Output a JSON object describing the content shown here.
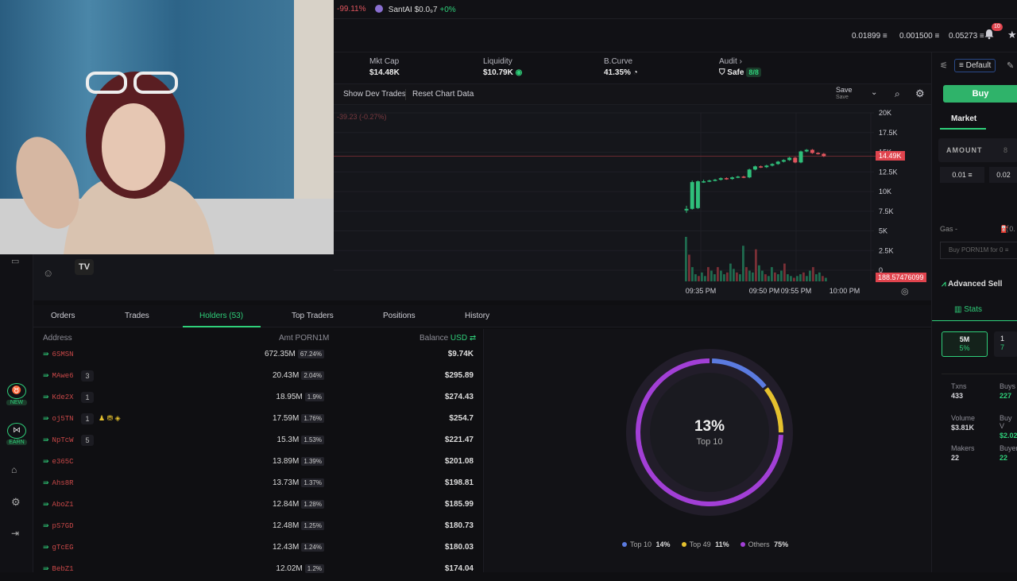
{
  "topbar": {
    "left_change": "-99.11%",
    "ticker_name": "SantAI",
    "ticker_price": "$0.0₉7",
    "ticker_change": "+0%"
  },
  "header": {
    "prices": [
      "0.01899 ≡",
      "0.001500 ≡",
      "0.05273 ≡"
    ],
    "notif_count": "10"
  },
  "stats": {
    "mktcap_label": "Mkt Cap",
    "mktcap": "$14.48K",
    "liquidity_label": "Liquidity",
    "liquidity": "$10.79K",
    "bcurve_label": "B.Curve",
    "bcurve": "41.35%",
    "audit_label": "Audit",
    "audit_status": "Safe",
    "audit_score": "8/8"
  },
  "chart_toolbar": {
    "show_dev": "Show Dev Trades",
    "reset": "Reset Chart Data",
    "save": "Save",
    "save_sub": "Save"
  },
  "chart_data": {
    "type": "candlestick",
    "change_label": "-39.23 (-0.27%)",
    "y_ticks": [
      "20K",
      "17.5K",
      "15K",
      "12.5K",
      "10K",
      "7.5K",
      "5K",
      "2.5K",
      "0"
    ],
    "y_tick_values": [
      20000,
      17500,
      15000,
      12500,
      10000,
      7500,
      5000,
      2500,
      0
    ],
    "x_ticks": [
      "09:35 PM",
      "09:50 PM",
      "09:55 PM",
      "10:00 PM"
    ],
    "current_price_label": "14.49K",
    "current_price": 14490,
    "volume_label": "188.57476099",
    "candles": [
      {
        "o": 7600,
        "c": 7800,
        "h": 8200,
        "l": 7300
      },
      {
        "o": 7800,
        "c": 11200,
        "h": 11400,
        "l": 7700
      },
      {
        "o": 7900,
        "c": 11300,
        "h": 11400,
        "l": 7800
      },
      {
        "o": 11200,
        "c": 11300,
        "h": 11500,
        "l": 11100
      },
      {
        "o": 11300,
        "c": 11400,
        "h": 11500,
        "l": 11200
      },
      {
        "o": 11400,
        "c": 11500,
        "h": 11600,
        "l": 11300
      },
      {
        "o": 11500,
        "c": 11700,
        "h": 11800,
        "l": 11400
      },
      {
        "o": 11700,
        "c": 11600,
        "h": 11800,
        "l": 11500
      },
      {
        "o": 11600,
        "c": 11800,
        "h": 11900,
        "l": 11500
      },
      {
        "o": 11800,
        "c": 11900,
        "h": 12000,
        "l": 11700
      },
      {
        "o": 11900,
        "c": 11800,
        "h": 12000,
        "l": 11700
      },
      {
        "o": 11800,
        "c": 12800,
        "h": 12900,
        "l": 11700
      },
      {
        "o": 12800,
        "c": 13200,
        "h": 13300,
        "l": 12700
      },
      {
        "o": 13200,
        "c": 13100,
        "h": 13300,
        "l": 13000
      },
      {
        "o": 13100,
        "c": 13300,
        "h": 13400,
        "l": 13000
      },
      {
        "o": 13300,
        "c": 13500,
        "h": 13600,
        "l": 13200
      },
      {
        "o": 13500,
        "c": 13800,
        "h": 13900,
        "l": 13400
      },
      {
        "o": 13800,
        "c": 14000,
        "h": 14100,
        "l": 13700
      },
      {
        "o": 14000,
        "c": 14300,
        "h": 14400,
        "l": 13900
      },
      {
        "o": 14300,
        "c": 13700,
        "h": 14400,
        "l": 13600
      },
      {
        "o": 13700,
        "c": 15100,
        "h": 15200,
        "l": 13600
      },
      {
        "o": 15100,
        "c": 15300,
        "h": 15400,
        "l": 15000
      },
      {
        "o": 15300,
        "c": 14900,
        "h": 15400,
        "l": 14800
      },
      {
        "o": 14900,
        "c": 14800,
        "h": 15000,
        "l": 14700
      },
      {
        "o": 14800,
        "c": 14500,
        "h": 14900,
        "l": 14400
      }
    ],
    "volumes": [
      25,
      15,
      8,
      4,
      3,
      5,
      3,
      8,
      6,
      4,
      8,
      6,
      4,
      5,
      10,
      7,
      5,
      4,
      20,
      8,
      6,
      5,
      18,
      9,
      6,
      4,
      3,
      8,
      5,
      4,
      6,
      10,
      4,
      3,
      2,
      3,
      4,
      5,
      3,
      6,
      8,
      4,
      5,
      3,
      2
    ]
  },
  "tabs": [
    "Orders",
    "Trades",
    "Holders (53)",
    "Top Traders",
    "Positions",
    "History"
  ],
  "table": {
    "col_address": "Address",
    "col_amt": "Amt PORN1M",
    "col_balance": "Balance",
    "col_currency": "USD",
    "rows": [
      {
        "addr": "6SMSN",
        "cnt": "",
        "amt": "672.35M",
        "pct": "67.24%",
        "bal": "$9.74K"
      },
      {
        "addr": "MAwe6",
        "cnt": "3",
        "amt": "20.43M",
        "pct": "2.04%",
        "bal": "$295.89"
      },
      {
        "addr": "Kde2X",
        "cnt": "1",
        "amt": "18.95M",
        "pct": "1.9%",
        "bal": "$274.43"
      },
      {
        "addr": "oj5TN",
        "cnt": "1",
        "amt": "17.59M",
        "pct": "1.76%",
        "bal": "$254.7"
      },
      {
        "addr": "NpTcW",
        "cnt": "5",
        "amt": "15.3M",
        "pct": "1.53%",
        "bal": "$221.47"
      },
      {
        "addr": "e365C",
        "cnt": "",
        "amt": "13.89M",
        "pct": "1.39%",
        "bal": "$201.08"
      },
      {
        "addr": "Ahs8R",
        "cnt": "",
        "amt": "13.73M",
        "pct": "1.37%",
        "bal": "$198.81"
      },
      {
        "addr": "AboZ1",
        "cnt": "",
        "amt": "12.84M",
        "pct": "1.28%",
        "bal": "$185.99"
      },
      {
        "addr": "pS7GD",
        "cnt": "",
        "amt": "12.48M",
        "pct": "1.25%",
        "bal": "$180.73"
      },
      {
        "addr": "gTcEG",
        "cnt": "",
        "amt": "12.43M",
        "pct": "1.24%",
        "bal": "$180.03"
      },
      {
        "addr": "BebZ1",
        "cnt": "",
        "amt": "12.02M",
        "pct": "1.2%",
        "bal": "$174.04"
      }
    ]
  },
  "donut": {
    "center_pct": "13%",
    "center_label": "Top 10",
    "legend": [
      {
        "name": "Top 10",
        "value": "14%",
        "color": "#5b7be0"
      },
      {
        "name": "Top 49",
        "value": "11%",
        "color": "#e5c12e"
      },
      {
        "name": "Others",
        "value": "75%",
        "color": "#a23fd6"
      }
    ],
    "segments": [
      {
        "value": 14,
        "color": "#5b7be0"
      },
      {
        "value": 11,
        "color": "#e5c12e"
      },
      {
        "value": 75,
        "color": "#a23fd6"
      }
    ]
  },
  "right_panel": {
    "preset": "Default",
    "buy": "Buy",
    "market": "Market",
    "amount": "AMOUNT",
    "amount_val": "8",
    "quick1": "0.01 ≡",
    "quick2": "0.02",
    "gas": "Gas -",
    "gas_val": "0.",
    "buy_for": "Buy PORN1M for 0 ≡",
    "adv_sell": "Advanced Sell",
    "stats_tab": "Stats",
    "tf1": "5M",
    "tf1_pct": "5%",
    "tf2": "1",
    "tf2_pct": "7",
    "txns_label": "Txns",
    "txns": "433",
    "buys_label": "Buys",
    "buys": "227",
    "volume_label": "Volume",
    "volume": "$3.81K",
    "buyv_label": "Buy V",
    "buyv": "$2.02",
    "makers_label": "Makers",
    "makers": "22",
    "buyers_label": "Buyer",
    "buyers": "22"
  },
  "sidebar": {
    "new": "NEW",
    "earn": "EARN"
  }
}
